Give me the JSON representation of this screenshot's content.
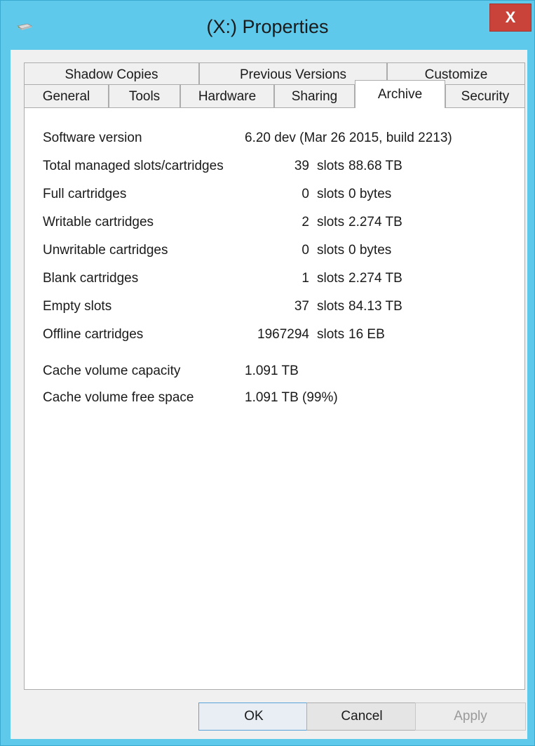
{
  "window": {
    "title": "(X:) Properties",
    "close_label": "X",
    "accent": "#5fc9eb",
    "close_color": "#c9433a"
  },
  "tabs": {
    "row1": [
      {
        "label": "Shadow Copies"
      },
      {
        "label": "Previous Versions"
      },
      {
        "label": "Customize"
      }
    ],
    "row2": [
      {
        "label": "General"
      },
      {
        "label": "Tools"
      },
      {
        "label": "Hardware"
      },
      {
        "label": "Sharing"
      },
      {
        "label": "Archive",
        "active": true
      },
      {
        "label": "Security"
      }
    ]
  },
  "archive": {
    "software_version_label": "Software version",
    "software_version_value": "6.20 dev (Mar 26 2015, build 2213)",
    "stats": [
      {
        "label": "Total managed slots/cartridges",
        "count": "39",
        "unit": "slots",
        "size": "88.68 TB"
      },
      {
        "label": "Full cartridges",
        "count": "0",
        "unit": "slots",
        "size": "0 bytes"
      },
      {
        "label": "Writable cartridges",
        "count": "2",
        "unit": "slots",
        "size": "2.274 TB"
      },
      {
        "label": "Unwritable cartridges",
        "count": "0",
        "unit": "slots",
        "size": "0 bytes"
      },
      {
        "label": "Blank cartridges",
        "count": "1",
        "unit": "slots",
        "size": "2.274 TB"
      },
      {
        "label": "Empty slots",
        "count": "37",
        "unit": "slots",
        "size": "84.13 TB"
      },
      {
        "label": "Offline cartridges",
        "count": "1967294",
        "unit": "slots",
        "size": "16 EB"
      }
    ],
    "cache_capacity_label": "Cache volume capacity",
    "cache_capacity_value": "1.091 TB",
    "cache_free_label": "Cache volume free space",
    "cache_free_value": "1.091 TB (99%)"
  },
  "buttons": {
    "ok": "OK",
    "cancel": "Cancel",
    "apply": "Apply"
  }
}
